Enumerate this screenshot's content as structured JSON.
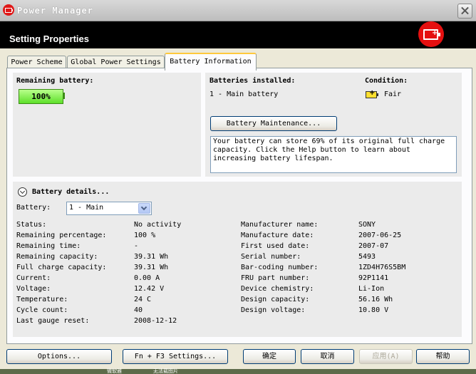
{
  "window": {
    "title": "Power Manager"
  },
  "header": {
    "title": "Setting Properties",
    "badge_icon": "battery-plus-icon"
  },
  "tabs": [
    {
      "label": "Power Scheme"
    },
    {
      "label": "Global Power Settings"
    },
    {
      "label": "Battery Information"
    }
  ],
  "remaining": {
    "label": "Remaining battery:",
    "value": "100%"
  },
  "installed": {
    "label": "Batteries installed:",
    "value": "1 - Main battery",
    "condition_label": "Condition:",
    "condition_value": "Fair",
    "maintenance_button": "Battery Maintenance...",
    "info_text": "Your battery can store 69% of its original full charge capacity. Click the Help button to learn about increasing battery lifespan."
  },
  "details": {
    "title": "Battery details...",
    "battery_label": "Battery:",
    "battery_selected": "1 - Main",
    "left": [
      {
        "label": "Status:",
        "value": "No activity"
      },
      {
        "label": "Remaining percentage:",
        "value": "100 %"
      },
      {
        "label": "Remaining time:",
        "value": "-"
      },
      {
        "label": "Remaining capacity:",
        "value": "39.31 Wh"
      },
      {
        "label": "Full charge capacity:",
        "value": "39.31 Wh"
      },
      {
        "label": "Current:",
        "value": "0.00 A"
      },
      {
        "label": "Voltage:",
        "value": "12.42 V"
      },
      {
        "label": "Temperature:",
        "value": "24 C"
      },
      {
        "label": "Cycle count:",
        "value": "40"
      },
      {
        "label": "Last gauge reset:",
        "value": "2008-12-12"
      }
    ],
    "right": [
      {
        "label": "Manufacturer name:",
        "value": "SONY"
      },
      {
        "label": "Manufacture date:",
        "value": "2007-06-25"
      },
      {
        "label": "First used date:",
        "value": "2007-07"
      },
      {
        "label": "Serial number:",
        "value": "5493"
      },
      {
        "label": "Bar-coding number:",
        "value": "1ZD4H76S5BM"
      },
      {
        "label": "FRU part number:",
        "value": "92P1141"
      },
      {
        "label": "Device chemistry:",
        "value": "Li-Ion"
      },
      {
        "label": "Design capacity:",
        "value": "56.16 Wh"
      },
      {
        "label": "Design voltage:",
        "value": "10.80 V"
      }
    ]
  },
  "buttons": {
    "options": "Options...",
    "fn_f3": "Fn + F3 Settings...",
    "ok": "确定",
    "cancel": "取消",
    "apply": "应用(A)",
    "help": "帮助"
  },
  "taskbar": {
    "text1": "微软雅",
    "text2": "无法载图片"
  },
  "colors": {
    "accent_red": "#e51010",
    "battery_green": "#5ee02a",
    "header_bg": "#000000",
    "tab_highlight": "#ffc83c"
  }
}
